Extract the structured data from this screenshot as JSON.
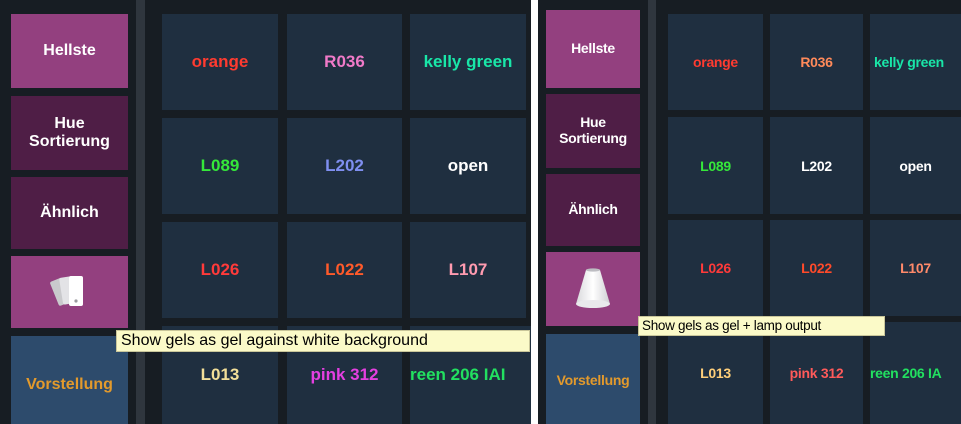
{
  "colors": {
    "background": "#171d23",
    "cell": "#1f2f40",
    "button_magenta": "#93407f",
    "button_plum": "#4f1e46",
    "button_blue": "#2d4b6c",
    "vorstellung_text": "#e39a2c",
    "tooltip_bg": "#fbfac8"
  },
  "panels": [
    {
      "sidebar": {
        "brightest": "Hellste",
        "hue_sort": "Hue\nSortierung",
        "similar": "Ähnlich",
        "mode_icon": "gel-swatches-icon",
        "performance": "Vorstellung"
      },
      "tooltip": "Show gels as gel against white background",
      "cells": [
        {
          "label": "orange",
          "color": "#ff3b30"
        },
        {
          "label": "R036",
          "color": "#f07ac8"
        },
        {
          "label": "kelly green",
          "color": "#19e6a8"
        },
        {
          "label": "L089",
          "color": "#35e83a"
        },
        {
          "label": "L202",
          "color": "#7f8ff0"
        },
        {
          "label": "open",
          "color": "#ffffff"
        },
        {
          "label": "L026",
          "color": "#ff3a3a"
        },
        {
          "label": "L022",
          "color": "#ff5a2a"
        },
        {
          "label": "L107",
          "color": "#ff9bb0"
        },
        {
          "label": "L013",
          "color": "#f2df99"
        },
        {
          "label": "pink 312",
          "color": "#e43fe0"
        },
        {
          "label": "reen 206 IAI",
          "color": "#22e060"
        }
      ]
    },
    {
      "sidebar": {
        "brightest": "Hellste",
        "hue_sort": "Hue\nSortierung",
        "similar": "Ähnlich",
        "mode_icon": "lamp-cone-icon",
        "performance": "Vorstellung"
      },
      "tooltip": "Show gels as gel + lamp output",
      "cells": [
        {
          "label": "orange",
          "color": "#ff3b30"
        },
        {
          "label": "R036",
          "color": "#ff8a5a"
        },
        {
          "label": "kelly green",
          "color": "#19e6a8"
        },
        {
          "label": "L089",
          "color": "#35e83a"
        },
        {
          "label": "L202",
          "color": "#ffffff"
        },
        {
          "label": "open",
          "color": "#ffffff"
        },
        {
          "label": "L026",
          "color": "#ff3a3a"
        },
        {
          "label": "L022",
          "color": "#ff4a2a"
        },
        {
          "label": "L107",
          "color": "#ff8a6a"
        },
        {
          "label": "L013",
          "color": "#ffcf7a"
        },
        {
          "label": "pink 312",
          "color": "#ff5a5a"
        },
        {
          "label": "reen 206 IA",
          "color": "#22e060"
        }
      ]
    }
  ]
}
